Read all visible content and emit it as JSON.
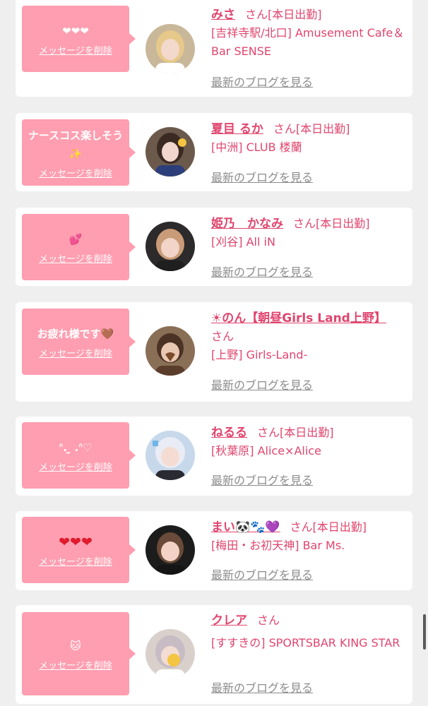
{
  "cards": [
    {
      "message": "❤❤❤",
      "delete_label": "メッセージを削除",
      "cast_name": "みさ",
      "honorific": "さん",
      "status": "[本日出勤]",
      "shop": "[吉祥寺駅/北口] Amusement Cafe＆Bar SENSE",
      "blog_label": "最新のブログを見る",
      "avatar": {
        "bg": "#c9b79a",
        "hair": "#e6c98a",
        "skin": "#f3d9cc",
        "cloth": "#ffffff"
      }
    },
    {
      "message": "ナースコス楽しそう✨",
      "delete_label": "メッセージを削除",
      "cast_name": "夏目 るか",
      "honorific": "さん",
      "status": "[本日出勤]",
      "shop": "[中洲] CLUB 楼蘭",
      "blog_label": "最新のブログを見る",
      "avatar": {
        "bg": "#6b5a4c",
        "hair": "#3a2a22",
        "skin": "#f0d6cc",
        "cloth": "#2d3f7a"
      }
    },
    {
      "message": "💕",
      "delete_label": "メッセージを削除",
      "cast_name": "姫乃　かなみ",
      "honorific": "さん",
      "status": "[本日出勤]",
      "shop": "[刈谷] All iN",
      "blog_label": "最新のブログを見る",
      "avatar": {
        "bg": "#2c2a2a",
        "hair": "#c99b78",
        "skin": "#f2d4c8",
        "cloth": "#1f1f1f"
      }
    },
    {
      "message": "お疲れ様です🤎",
      "delete_label": "メッセージを削除",
      "cast_name": "☀のん【朝昼Girls Land上野】",
      "honorific": "さん",
      "status": "",
      "shop": "[上野] Girls-Land-",
      "blog_label": "最新のブログを見る",
      "avatar": {
        "bg": "#8a6f57",
        "hair": "#4a3324",
        "skin": "#e9c7b3",
        "cloth": "#5a3d2b"
      }
    },
    {
      "message": "ᐢ. ̫ .ᐢ♡",
      "delete_label": "メッセージを削除",
      "cast_name": "ねるる",
      "honorific": "さん",
      "status": "[本日出勤]",
      "shop": "[秋葉原] Alice×Alice",
      "blog_label": "最新のブログを見る",
      "avatar": {
        "bg": "#c7d8ea",
        "hair": "#e9ecf5",
        "skin": "#f5dcd2",
        "cloth": "#2a2a33"
      }
    },
    {
      "message": "❤❤❤",
      "delete_label": "メッセージを削除",
      "cast_name": "まい🐼🐾💜",
      "honorific": "さん",
      "status": "[本日出勤]",
      "shop": "[梅田・お初天神] Bar Ms.",
      "blog_label": "最新のブログを見る",
      "avatar": {
        "bg": "#1c1c1c",
        "hair": "#6a4a38",
        "skin": "#f1d2c4",
        "cloth": "#151515"
      }
    },
    {
      "message": "🐱",
      "delete_label": "メッセージを削除",
      "cast_name": "クレア",
      "honorific": "さん",
      "status": "",
      "shop": "[すすきの] SPORTSBAR KING STAR",
      "blog_label": "最新のブログを見る",
      "avatar": {
        "bg": "#d9d0cc",
        "hair": "#c7bcc4",
        "skin": "#f3dcd2",
        "cloth": "#ffffff"
      }
    }
  ]
}
